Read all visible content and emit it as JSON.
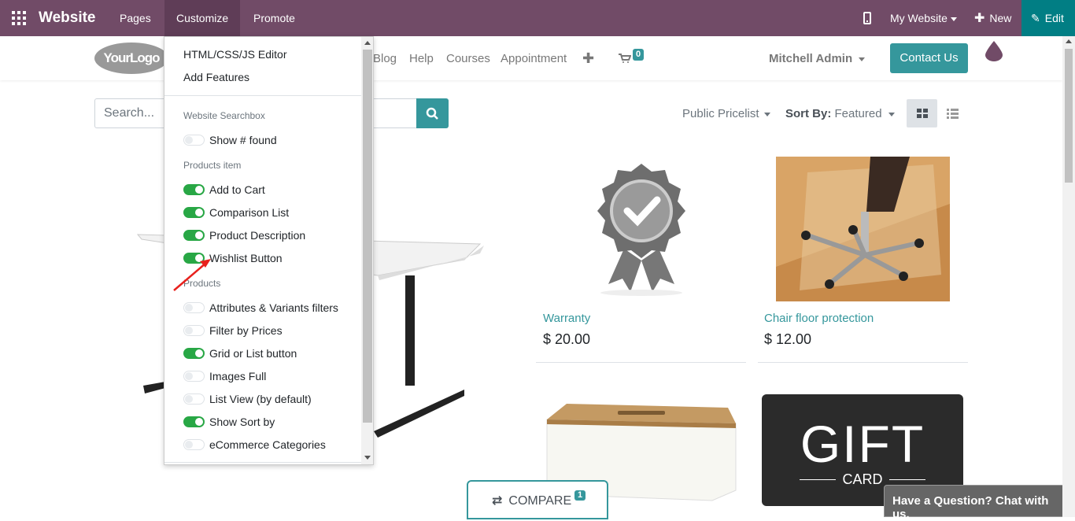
{
  "topbar": {
    "brand": "Website",
    "menus": [
      "Pages",
      "Customize",
      "Promote"
    ],
    "my_website": "My Website",
    "new_label": "New",
    "edit_label": "Edit"
  },
  "navbar": {
    "logo_text": "YourLogo",
    "links": [
      "Blog",
      "Help",
      "Courses",
      "Appointment"
    ],
    "cart_count": "0",
    "user": "Mitchell Admin",
    "contact_label": "Contact Us"
  },
  "search": {
    "placeholder": "Search..."
  },
  "filters": {
    "pricelist": "Public Pricelist",
    "sort_prefix": "Sort By:",
    "sort_value": "Featured"
  },
  "dropdown": {
    "items": [
      "HTML/CSS/JS Editor",
      "Add Features"
    ],
    "sections": [
      {
        "header": "Website Searchbox",
        "options": [
          {
            "label": "Show # found",
            "on": false
          }
        ]
      },
      {
        "header": "Products item",
        "options": [
          {
            "label": "Add to Cart",
            "on": true
          },
          {
            "label": "Comparison List",
            "on": true
          },
          {
            "label": "Product Description",
            "on": true
          },
          {
            "label": "Wishlist Button",
            "on": true
          }
        ]
      },
      {
        "header": "Products",
        "options": [
          {
            "label": "Attributes & Variants filters",
            "on": false
          },
          {
            "label": "Filter by Prices",
            "on": false
          },
          {
            "label": "Grid or List button",
            "on": true
          },
          {
            "label": "Images Full",
            "on": false
          },
          {
            "label": "List View (by default)",
            "on": false
          },
          {
            "label": "Show Sort by",
            "on": true
          },
          {
            "label": "eCommerce Categories",
            "on": false
          }
        ]
      }
    ]
  },
  "products": [
    {
      "name": "Warranty",
      "price": "$ 20.00"
    },
    {
      "name": "Chair floor protection",
      "price": "$ 12.00"
    }
  ],
  "gift_card": {
    "line1": "GIFT",
    "line2": "CARD"
  },
  "compare": {
    "label": "COMPARE",
    "count": "1"
  },
  "chat": {
    "label": "Have a Question? Chat with us."
  },
  "colors": {
    "topbar": "#714b67",
    "accent": "#35979c",
    "edit": "#017e84",
    "toggle_on": "#28a745",
    "annotation_arrow": "#e8211d"
  }
}
